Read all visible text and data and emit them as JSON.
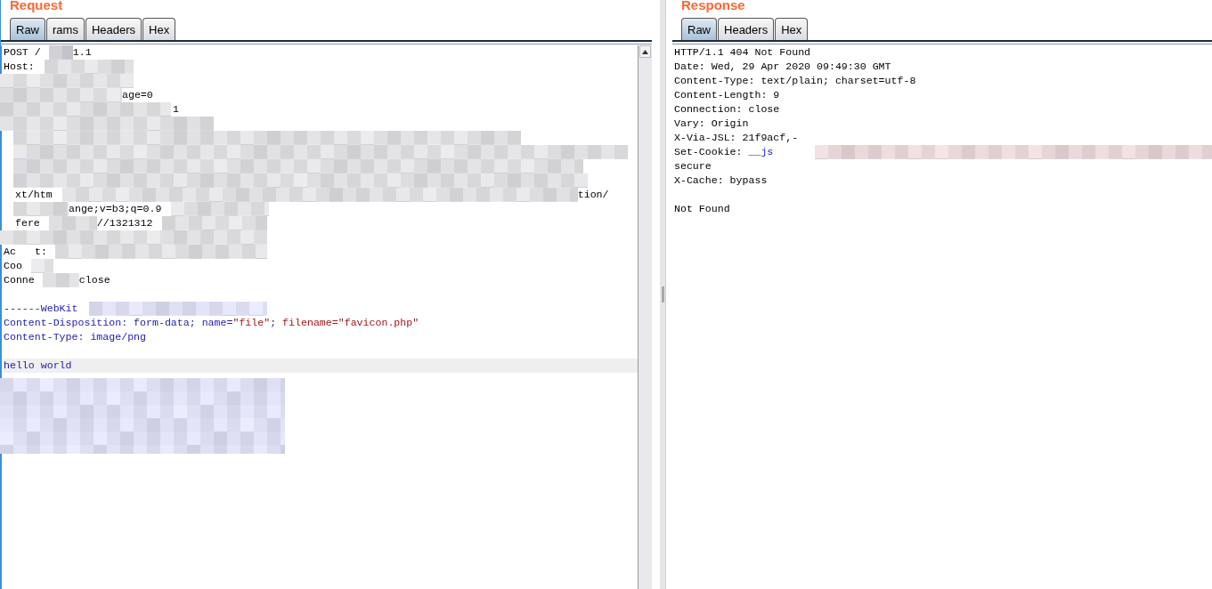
{
  "request": {
    "title": "Request",
    "tabs": [
      {
        "label": "Raw",
        "selected": true
      },
      {
        "label": "rams",
        "selected": false
      },
      {
        "label": "Headers",
        "selected": false
      },
      {
        "label": "Hex",
        "selected": false
      }
    ],
    "lines": [
      {
        "kind": "plain",
        "segments": [
          {
            "kind": "text",
            "text": "POST /"
          },
          {
            "kind": "text",
            "text": "1.1"
          }
        ]
      },
      {
        "kind": "plain",
        "segments": [
          {
            "kind": "text",
            "text": "Host:"
          }
        ]
      },
      {
        "kind": "plain"
      },
      {
        "kind": "plain",
        "segments": [
          {
            "kind": "text",
            "text": "age=0"
          }
        ]
      },
      {
        "kind": "plain",
        "segments": [
          {
            "kind": "text",
            "text": "1"
          }
        ]
      },
      {
        "kind": "plain"
      },
      {
        "kind": "plain"
      },
      {
        "kind": "plain"
      },
      {
        "kind": "plain"
      },
      {
        "kind": "plain"
      },
      {
        "kind": "plain",
        "segments": [
          {
            "kind": "text",
            "text": "xt/htm"
          },
          {
            "kind": "text",
            "text": "tion/"
          }
        ]
      },
      {
        "kind": "plain",
        "segments": [
          {
            "kind": "text",
            "text": "ange;v=b3;q=0.9"
          }
        ]
      },
      {
        "kind": "plain",
        "segments": [
          {
            "kind": "text",
            "text": "fere"
          },
          {
            "kind": "text",
            "text": "//1321312"
          }
        ]
      },
      {
        "kind": "plain"
      },
      {
        "kind": "plain",
        "segments": [
          {
            "kind": "text",
            "text": "Ac"
          },
          {
            "kind": "text",
            "text": "t:"
          }
        ]
      },
      {
        "kind": "plain",
        "segments": [
          {
            "kind": "text",
            "text": "Coo"
          }
        ]
      },
      {
        "kind": "plain",
        "segments": [
          {
            "kind": "text",
            "text": "Conne"
          },
          {
            "kind": "text",
            "text": "close"
          }
        ]
      },
      {
        "kind": "plain"
      },
      {
        "kind": "plain",
        "segments": [
          {
            "kind": "name",
            "text": "------WebKit"
          }
        ]
      },
      {
        "kind": "plain",
        "segments": [
          {
            "kind": "name",
            "text": "Content-Disposition: form-data; name="
          },
          {
            "kind": "string",
            "text": "\"file\""
          },
          {
            "kind": "name",
            "text": "; "
          },
          {
            "kind": "string",
            "text": "filename=\"favicon.php\""
          }
        ]
      },
      {
        "kind": "plain",
        "segments": [
          {
            "kind": "name",
            "text": "Content-Type: image/png"
          }
        ]
      },
      {
        "kind": "plain"
      },
      {
        "kind": "highlight",
        "segments": [
          {
            "kind": "name",
            "text": "hello world"
          }
        ]
      }
    ]
  },
  "response": {
    "title": "Response",
    "tabs": [
      {
        "label": "Raw",
        "selected": true
      },
      {
        "label": "Headers",
        "selected": false
      },
      {
        "label": "Hex",
        "selected": false
      }
    ],
    "lines": [
      {
        "segments": [
          {
            "kind": "text",
            "text": "HTTP/1.1 404 Not Found"
          }
        ]
      },
      {
        "segments": [
          {
            "kind": "text",
            "text": "Date: Wed, 29 Apr 2020 09:49:30 GMT"
          }
        ]
      },
      {
        "segments": [
          {
            "kind": "text",
            "text": "Content-Type: text/plain; charset=utf-8"
          }
        ]
      },
      {
        "segments": [
          {
            "kind": "text",
            "text": "Content-Length: 9"
          }
        ]
      },
      {
        "segments": [
          {
            "kind": "text",
            "text": "Connection: close"
          }
        ]
      },
      {
        "segments": [
          {
            "kind": "text",
            "text": "Vary: Origin"
          }
        ]
      },
      {
        "segments": [
          {
            "kind": "text",
            "text": "X-Via-JSL: 21f9acf,-"
          }
        ]
      },
      {
        "segments": [
          {
            "kind": "text",
            "text": "Set-Cookie: "
          },
          {
            "kind": "name",
            "text": "__js"
          }
        ]
      },
      {
        "segments": [
          {
            "kind": "text",
            "text": "secure"
          }
        ]
      },
      {
        "segments": [
          {
            "kind": "text",
            "text": "X-Cache: bypass"
          }
        ]
      }
    ],
    "body": [
      "Not Found"
    ]
  }
}
